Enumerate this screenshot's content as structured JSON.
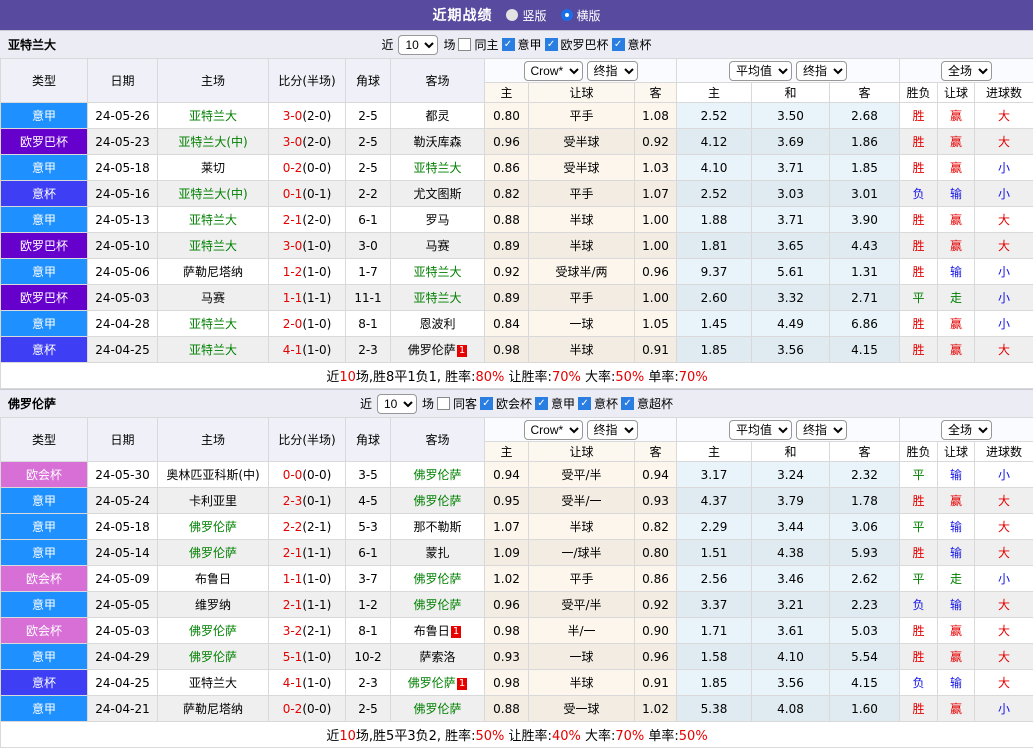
{
  "title_bar": {
    "title": "近期战绩",
    "radio_vertical": "竖版",
    "radio_horizontal": "横版",
    "selected": "横版"
  },
  "table_header": {
    "main": [
      "类型",
      "日期",
      "主场",
      "比分(半场)",
      "角球",
      "客场"
    ],
    "sub": [
      "主",
      "让球",
      "客",
      "主",
      "和",
      "客",
      "胜负",
      "让球",
      "进球数"
    ],
    "dd_group1": [
      "Crow*",
      "终指"
    ],
    "dd_group2": [
      "平均值",
      "终指"
    ],
    "dd_group3": [
      "全场"
    ]
  },
  "colors": {
    "type": {
      "意甲": "#1e90ff",
      "欧罗巴杯": "#6600cc",
      "意杯": "#3e3ef5",
      "欧会杯": "#d76fd7"
    },
    "result": {
      "胜": "#e60000",
      "负": "#1414e6",
      "平": "#008000",
      "赢": "#e60000",
      "输": "#1414e6",
      "走": "#008000",
      "大": "#e60000",
      "小": "#1414e6"
    }
  },
  "sections": [
    {
      "team": "亚特兰大",
      "filter": {
        "near": "近",
        "count": "10",
        "unit": "场",
        "same": "同主",
        "same_checked": false,
        "leagues": [
          "意甲",
          "欧罗巴杯",
          "意杯"
        ]
      },
      "rows": [
        {
          "type": "意甲",
          "date": "24-05-26",
          "home": "亚特兰大",
          "home_self": true,
          "score": "3-0",
          "half": "(2-0)",
          "corner": "2-5",
          "away": "都灵",
          "away_self": false,
          "badge": "",
          "odds": [
            "0.80",
            "平手",
            "1.08"
          ],
          "avg": [
            "2.52",
            "3.50",
            "2.68"
          ],
          "res": [
            "胜",
            "赢",
            "大"
          ]
        },
        {
          "type": "欧罗巴杯",
          "date": "24-05-23",
          "home": "亚特兰大(中)",
          "home_self": true,
          "score": "3-0",
          "half": "(2-0)",
          "corner": "2-5",
          "away": "勒沃库森",
          "away_self": false,
          "badge": "",
          "odds": [
            "0.96",
            "受半球",
            "0.92"
          ],
          "avg": [
            "4.12",
            "3.69",
            "1.86"
          ],
          "res": [
            "胜",
            "赢",
            "大"
          ]
        },
        {
          "type": "意甲",
          "date": "24-05-18",
          "home": "莱切",
          "home_self": false,
          "score": "0-2",
          "half": "(0-0)",
          "corner": "2-5",
          "away": "亚特兰大",
          "away_self": true,
          "badge": "",
          "odds": [
            "0.86",
            "受半球",
            "1.03"
          ],
          "avg": [
            "4.10",
            "3.71",
            "1.85"
          ],
          "res": [
            "胜",
            "赢",
            "小"
          ]
        },
        {
          "type": "意杯",
          "date": "24-05-16",
          "home": "亚特兰大(中)",
          "home_self": true,
          "score": "0-1",
          "half": "(0-1)",
          "corner": "2-2",
          "away": "尤文图斯",
          "away_self": false,
          "badge": "",
          "odds": [
            "0.82",
            "平手",
            "1.07"
          ],
          "avg": [
            "2.52",
            "3.03",
            "3.01"
          ],
          "res": [
            "负",
            "输",
            "小"
          ]
        },
        {
          "type": "意甲",
          "date": "24-05-13",
          "home": "亚特兰大",
          "home_self": true,
          "score": "2-1",
          "half": "(2-0)",
          "corner": "6-1",
          "away": "罗马",
          "away_self": false,
          "badge": "",
          "odds": [
            "0.88",
            "半球",
            "1.00"
          ],
          "avg": [
            "1.88",
            "3.71",
            "3.90"
          ],
          "res": [
            "胜",
            "赢",
            "大"
          ]
        },
        {
          "type": "欧罗巴杯",
          "date": "24-05-10",
          "home": "亚特兰大",
          "home_self": true,
          "score": "3-0",
          "half": "(1-0)",
          "corner": "3-0",
          "away": "马赛",
          "away_self": false,
          "badge": "",
          "odds": [
            "0.89",
            "半球",
            "1.00"
          ],
          "avg": [
            "1.81",
            "3.65",
            "4.43"
          ],
          "res": [
            "胜",
            "赢",
            "大"
          ]
        },
        {
          "type": "意甲",
          "date": "24-05-06",
          "home": "萨勒尼塔纳",
          "home_self": false,
          "score": "1-2",
          "half": "(1-0)",
          "corner": "1-7",
          "away": "亚特兰大",
          "away_self": true,
          "badge": "",
          "odds": [
            "0.92",
            "受球半/两",
            "0.96"
          ],
          "avg": [
            "9.37",
            "5.61",
            "1.31"
          ],
          "res": [
            "胜",
            "输",
            "小"
          ]
        },
        {
          "type": "欧罗巴杯",
          "date": "24-05-03",
          "home": "马赛",
          "home_self": false,
          "score": "1-1",
          "half": "(1-1)",
          "corner": "11-1",
          "away": "亚特兰大",
          "away_self": true,
          "badge": "",
          "odds": [
            "0.89",
            "平手",
            "1.00"
          ],
          "avg": [
            "2.60",
            "3.32",
            "2.71"
          ],
          "res": [
            "平",
            "走",
            "小"
          ]
        },
        {
          "type": "意甲",
          "date": "24-04-28",
          "home": "亚特兰大",
          "home_self": true,
          "score": "2-0",
          "half": "(1-0)",
          "corner": "8-1",
          "away": "恩波利",
          "away_self": false,
          "badge": "",
          "odds": [
            "0.84",
            "一球",
            "1.05"
          ],
          "avg": [
            "1.45",
            "4.49",
            "6.86"
          ],
          "res": [
            "胜",
            "赢",
            "小"
          ]
        },
        {
          "type": "意杯",
          "date": "24-04-25",
          "home": "亚特兰大",
          "home_self": true,
          "score": "4-1",
          "half": "(1-0)",
          "corner": "2-3",
          "away": "佛罗伦萨",
          "away_self": false,
          "badge": "1",
          "odds": [
            "0.98",
            "半球",
            "0.91"
          ],
          "avg": [
            "1.85",
            "3.56",
            "4.15"
          ],
          "res": [
            "胜",
            "赢",
            "大"
          ]
        }
      ],
      "summary": [
        [
          "近",
          "k"
        ],
        [
          "10",
          "r"
        ],
        [
          "场,胜8平1负1, 胜率:",
          "k"
        ],
        [
          "80%",
          "r"
        ],
        [
          " 让胜率:",
          "k"
        ],
        [
          "70%",
          "r"
        ],
        [
          " 大率:",
          "k"
        ],
        [
          "50%",
          "r"
        ],
        [
          " 单率:",
          "k"
        ],
        [
          "70%",
          "r"
        ]
      ]
    },
    {
      "team": "佛罗伦萨",
      "filter": {
        "near": "近",
        "count": "10",
        "unit": "场",
        "same": "同客",
        "same_checked": false,
        "leagues": [
          "欧会杯",
          "意甲",
          "意杯",
          "意超杯"
        ]
      },
      "rows": [
        {
          "type": "欧会杯",
          "date": "24-05-30",
          "home": "奥林匹亚科斯(中)",
          "home_self": false,
          "score": "0-0",
          "half": "(0-0)",
          "corner": "3-5",
          "away": "佛罗伦萨",
          "away_self": true,
          "badge": "",
          "odds": [
            "0.94",
            "受平/半",
            "0.94"
          ],
          "avg": [
            "3.17",
            "3.24",
            "2.32"
          ],
          "res": [
            "平",
            "输",
            "小"
          ]
        },
        {
          "type": "意甲",
          "date": "24-05-24",
          "home": "卡利亚里",
          "home_self": false,
          "score": "2-3",
          "half": "(0-1)",
          "corner": "4-5",
          "away": "佛罗伦萨",
          "away_self": true,
          "badge": "",
          "odds": [
            "0.95",
            "受半/一",
            "0.93"
          ],
          "avg": [
            "4.37",
            "3.79",
            "1.78"
          ],
          "res": [
            "胜",
            "赢",
            "大"
          ]
        },
        {
          "type": "意甲",
          "date": "24-05-18",
          "home": "佛罗伦萨",
          "home_self": true,
          "score": "2-2",
          "half": "(2-1)",
          "corner": "5-3",
          "away": "那不勒斯",
          "away_self": false,
          "badge": "",
          "odds": [
            "1.07",
            "半球",
            "0.82"
          ],
          "avg": [
            "2.29",
            "3.44",
            "3.06"
          ],
          "res": [
            "平",
            "输",
            "大"
          ]
        },
        {
          "type": "意甲",
          "date": "24-05-14",
          "home": "佛罗伦萨",
          "home_self": true,
          "score": "2-1",
          "half": "(1-1)",
          "corner": "6-1",
          "away": "蒙扎",
          "away_self": false,
          "badge": "",
          "odds": [
            "1.09",
            "一/球半",
            "0.80"
          ],
          "avg": [
            "1.51",
            "4.38",
            "5.93"
          ],
          "res": [
            "胜",
            "输",
            "大"
          ]
        },
        {
          "type": "欧会杯",
          "date": "24-05-09",
          "home": "布鲁日",
          "home_self": false,
          "score": "1-1",
          "half": "(1-0)",
          "corner": "3-7",
          "away": "佛罗伦萨",
          "away_self": true,
          "badge": "",
          "odds": [
            "1.02",
            "平手",
            "0.86"
          ],
          "avg": [
            "2.56",
            "3.46",
            "2.62"
          ],
          "res": [
            "平",
            "走",
            "小"
          ]
        },
        {
          "type": "意甲",
          "date": "24-05-05",
          "home": "维罗纳",
          "home_self": false,
          "score": "2-1",
          "half": "(1-1)",
          "corner": "1-2",
          "away": "佛罗伦萨",
          "away_self": true,
          "badge": "",
          "odds": [
            "0.96",
            "受平/半",
            "0.92"
          ],
          "avg": [
            "3.37",
            "3.21",
            "2.23"
          ],
          "res": [
            "负",
            "输",
            "大"
          ]
        },
        {
          "type": "欧会杯",
          "date": "24-05-03",
          "home": "佛罗伦萨",
          "home_self": true,
          "score": "3-2",
          "half": "(2-1)",
          "corner": "8-1",
          "away": "布鲁日",
          "away_self": false,
          "badge": "1",
          "odds": [
            "0.98",
            "半/一",
            "0.90"
          ],
          "avg": [
            "1.71",
            "3.61",
            "5.03"
          ],
          "res": [
            "胜",
            "赢",
            "大"
          ]
        },
        {
          "type": "意甲",
          "date": "24-04-29",
          "home": "佛罗伦萨",
          "home_self": true,
          "score": "5-1",
          "half": "(1-0)",
          "corner": "10-2",
          "away": "萨索洛",
          "away_self": false,
          "badge": "",
          "odds": [
            "0.93",
            "一球",
            "0.96"
          ],
          "avg": [
            "1.58",
            "4.10",
            "5.54"
          ],
          "res": [
            "胜",
            "赢",
            "大"
          ]
        },
        {
          "type": "意杯",
          "date": "24-04-25",
          "home": "亚特兰大",
          "home_self": false,
          "score": "4-1",
          "half": "(1-0)",
          "corner": "2-3",
          "away": "佛罗伦萨",
          "away_self": true,
          "badge": "1",
          "odds": [
            "0.98",
            "半球",
            "0.91"
          ],
          "avg": [
            "1.85",
            "3.56",
            "4.15"
          ],
          "res": [
            "负",
            "输",
            "大"
          ]
        },
        {
          "type": "意甲",
          "date": "24-04-21",
          "home": "萨勒尼塔纳",
          "home_self": false,
          "score": "0-2",
          "half": "(0-0)",
          "corner": "2-5",
          "away": "佛罗伦萨",
          "away_self": true,
          "badge": "",
          "odds": [
            "0.88",
            "受一球",
            "1.02"
          ],
          "avg": [
            "5.38",
            "4.08",
            "1.60"
          ],
          "res": [
            "胜",
            "赢",
            "小"
          ]
        }
      ],
      "summary": [
        [
          "近",
          "k"
        ],
        [
          "10",
          "r"
        ],
        [
          "场,胜5平3负2, 胜率:",
          "k"
        ],
        [
          "50%",
          "r"
        ],
        [
          " 让胜率:",
          "k"
        ],
        [
          "40%",
          "r"
        ],
        [
          " 大率:",
          "k"
        ],
        [
          "70%",
          "r"
        ],
        [
          " 单率:",
          "k"
        ],
        [
          "50%",
          "r"
        ]
      ]
    }
  ]
}
